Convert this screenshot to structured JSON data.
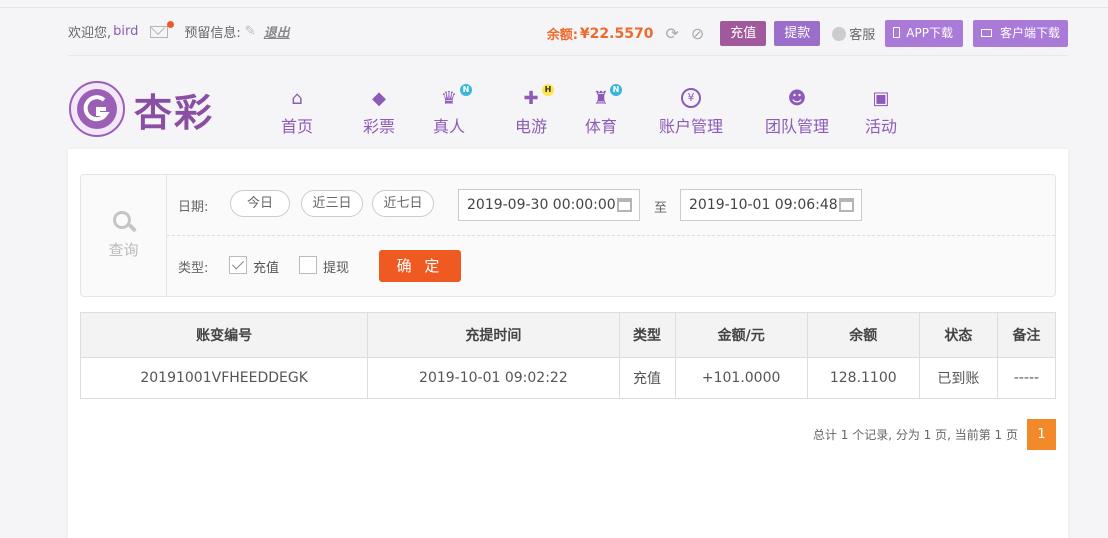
{
  "topbar": {
    "welcome": "欢迎您,",
    "username": "bird",
    "notice_label": "预留信息:",
    "logout": "退出",
    "balance_label": "余额:",
    "balance_value": "¥22.5570",
    "recharge": "充值",
    "withdraw": "提款",
    "customer_service": "客服",
    "app_download": "APP下载",
    "client_download": "客户端下载"
  },
  "logo": {
    "text": "杏彩"
  },
  "nav": [
    {
      "label": "首页",
      "icon": "home-icon",
      "glyph": "⌂"
    },
    {
      "label": "彩票",
      "icon": "lottery-ticket-icon",
      "glyph": "◆"
    },
    {
      "label": "真人",
      "icon": "live-dealer-icon",
      "glyph": "♛",
      "tag": "N"
    },
    {
      "label": "电游",
      "icon": "gamepad-icon",
      "glyph": "✚",
      "tag": "H"
    },
    {
      "label": "体育",
      "icon": "trophy-icon",
      "glyph": "♜",
      "tag": "N"
    },
    {
      "label": "账户管理",
      "icon": "account-coin-icon",
      "glyph": "¥"
    },
    {
      "label": "团队管理",
      "icon": "team-icon",
      "glyph": "☻"
    },
    {
      "label": "活动",
      "icon": "gift-icon",
      "glyph": "▣"
    }
  ],
  "search": {
    "query_label": "查询",
    "date_label": "日期:",
    "quick_dates": [
      "今日",
      "近三日",
      "近七日"
    ],
    "start_datetime": "2019-09-30 00:00:00",
    "to_label": "至",
    "end_datetime": "2019-10-01 09:06:48",
    "type_label": "类型:",
    "type_recharge": "充值",
    "type_withdraw": "提现",
    "recharge_checked": true,
    "withdraw_checked": false,
    "confirm": "确 定"
  },
  "table": {
    "headers": [
      "账变编号",
      "充提时间",
      "类型",
      "金额/元",
      "余额",
      "状态",
      "备注"
    ],
    "rows": [
      [
        "20191001VFHEEDDEGK",
        "2019-10-01 09:02:22",
        "充值",
        "+101.0000",
        "128.1100",
        "已到账",
        "-----"
      ]
    ]
  },
  "pager": {
    "summary": "总计 1 个记录, 分为 1 页, 当前第 1 页",
    "current_page": "1"
  },
  "colors": {
    "brand_purple": "#8c5bb8",
    "balance_orange": "#ee6a2c",
    "confirm_orange": "#ef5a22",
    "amount_red": "#d52b2b",
    "status_green": "#3a9a2a"
  }
}
